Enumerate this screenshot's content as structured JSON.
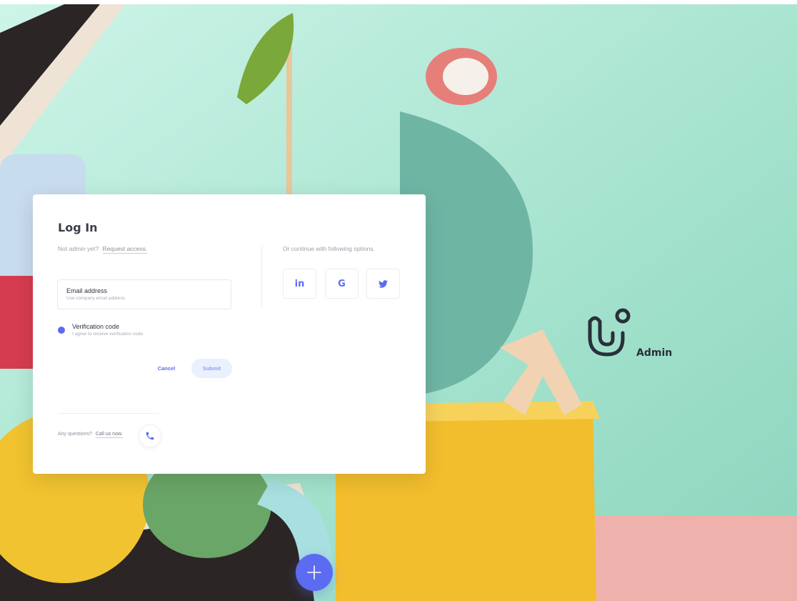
{
  "login": {
    "title": "Log In",
    "not_admin_text": "Not admin yet?",
    "request_access_link": "Request access.",
    "email": {
      "label": "Email address",
      "hint": "Use company email address"
    },
    "verification": {
      "label": "Verification code",
      "hint": "I agree to receive verification code",
      "selected": true
    },
    "cancel_label": "Cancel",
    "submit_label": "Submit",
    "questions_text": "Any questions?",
    "call_link": "Call us now."
  },
  "social": {
    "heading": "Or continue with following options.",
    "providers": [
      {
        "name": "linkedin",
        "glyph": "in",
        "icon": "linkedin-icon"
      },
      {
        "name": "google",
        "glyph": "G",
        "icon": "google-icon"
      },
      {
        "name": "twitter",
        "icon": "twitter-bird-icon"
      }
    ]
  },
  "brand": {
    "name": "Admin",
    "logo_icon": "stethoscope-u-logo"
  },
  "fab": {
    "icon": "plus-icon"
  },
  "theme": {
    "accent": "#5b6cf2",
    "background": "#a6e3cf",
    "card": "#ffffff",
    "text_dark": "#2f3440",
    "text_muted": "#9aa0aa"
  }
}
